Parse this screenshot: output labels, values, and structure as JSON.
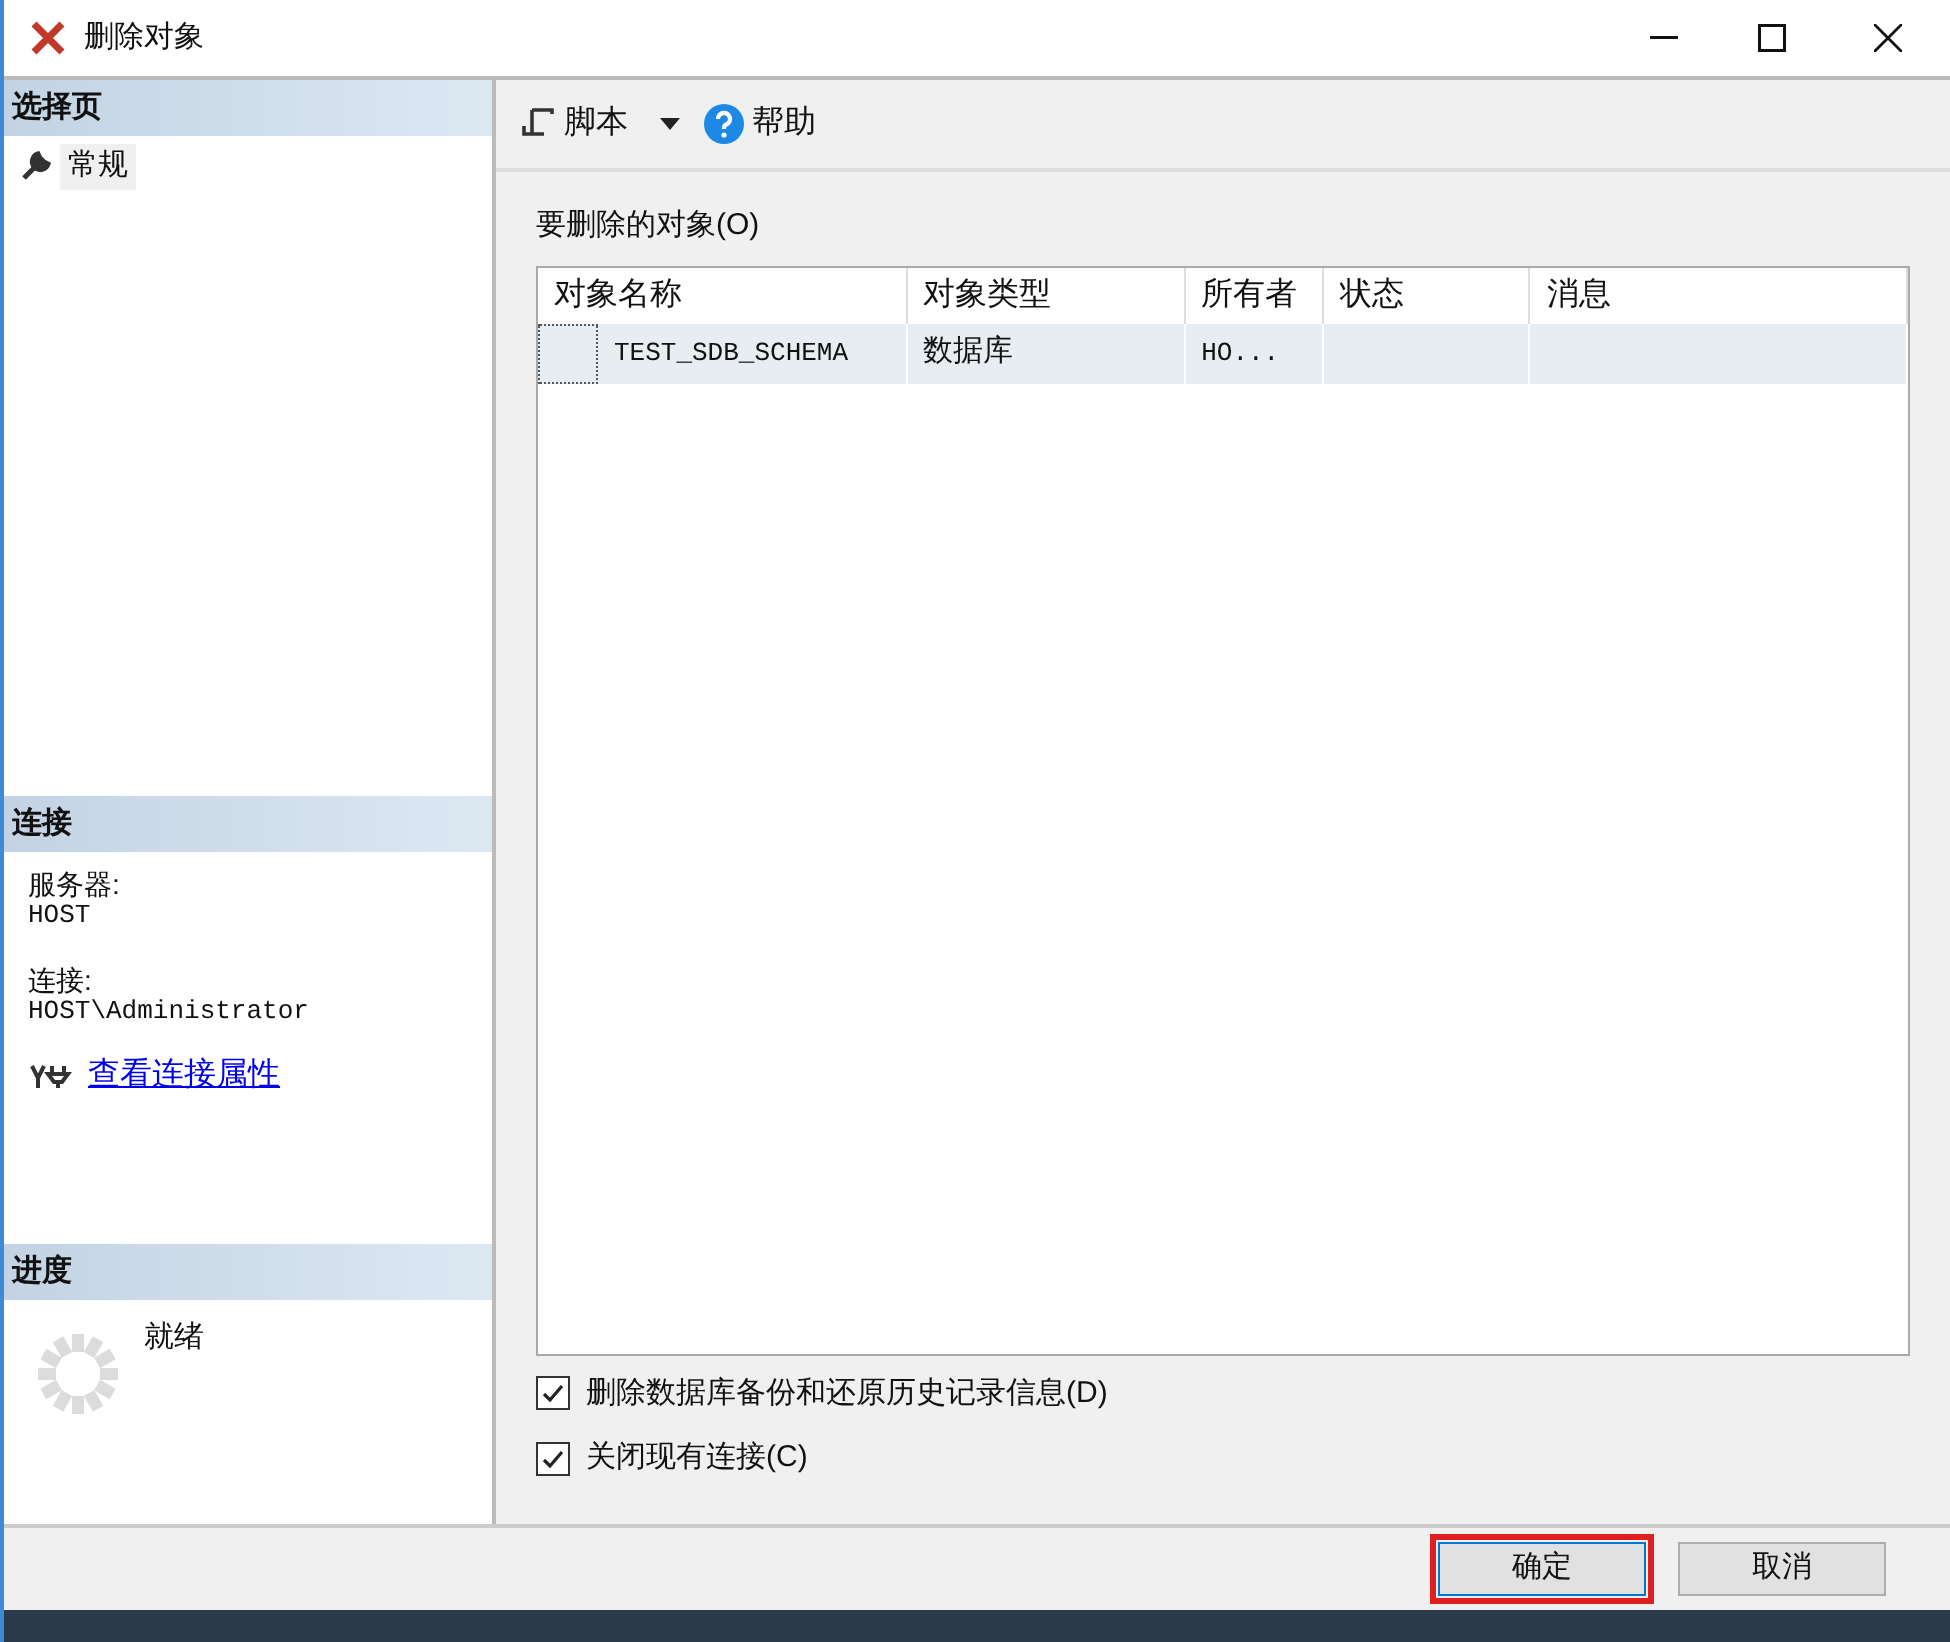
{
  "window": {
    "title": "删除对象"
  },
  "sidebar": {
    "pages_header": "选择页",
    "pages": [
      {
        "label": "常规",
        "selected": true
      }
    ],
    "connection_header": "连接",
    "server_label": "服务器:",
    "server_value": "HOST",
    "connection_label": "连接:",
    "connection_value": "HOST\\Administrator",
    "connection_link": "查看连接属性",
    "progress_header": "进度",
    "progress_status": "就绪"
  },
  "toolbar": {
    "script_label": "脚本",
    "help_label": "帮助"
  },
  "objects": {
    "title": "要删除的对象(O)",
    "columns": [
      "对象名称",
      "对象类型",
      "所有者",
      "状态",
      "消息"
    ],
    "rows": [
      {
        "selected": true,
        "cells": [
          "TEST_SDB_SCHEMA",
          "数据库",
          "HO...",
          "",
          ""
        ]
      }
    ]
  },
  "options": [
    {
      "label": "删除数据库备份和还原历史记录信息(D)",
      "checked": true
    },
    {
      "label": "关闭现有连接(C)",
      "checked": true
    }
  ],
  "buttons": [
    {
      "label": "确定",
      "highlighted": true
    },
    {
      "label": "取消",
      "highlighted": false
    }
  ]
}
